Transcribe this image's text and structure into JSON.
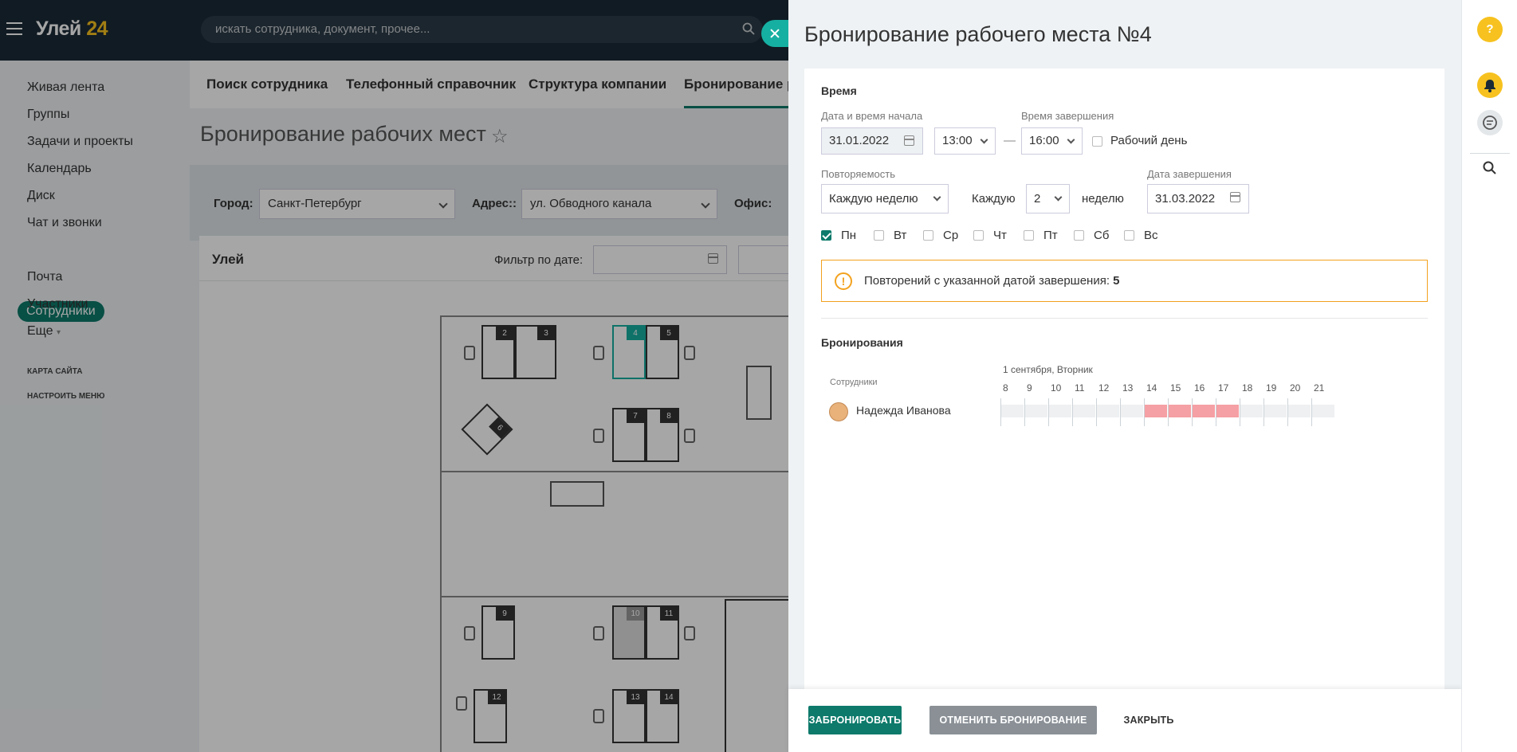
{
  "header": {
    "logo_main": "Улей",
    "logo_num": "24",
    "search_placeholder": "искать сотрудника, документ, прочее..."
  },
  "left_menu": {
    "items": [
      "Живая лента",
      "Группы",
      "Задачи и проекты",
      "Календарь",
      "Диск",
      "Чат и звонки",
      "Сотрудники",
      "Почта",
      "Участники",
      "Еще"
    ],
    "more_suffix": "▾",
    "captions": [
      "КАРТА САЙТА",
      "НАСТРОИТЬ МЕНЮ"
    ]
  },
  "main": {
    "tabs": [
      "Поиск сотрудника",
      "Телефонный справочник",
      "Структура компании",
      "Бронирование ра"
    ],
    "page_title": "Бронирование рабочих мест",
    "filter": {
      "city_label": "Город:",
      "city_value": "Санкт-Петербург",
      "address_label": "Адрес::",
      "address_value": "ул. Обводного канала",
      "office_label": "Офис:"
    },
    "card_title": "Улей",
    "date_filter_label": "Фильтр по дате:",
    "desks": [
      "2",
      "3",
      "4",
      "5",
      "6",
      "7",
      "8",
      "9",
      "10",
      "11",
      "12",
      "13",
      "14"
    ]
  },
  "slider": {
    "title": "Бронирование рабочего места №4",
    "time_section": "Время",
    "start_label": "Дата и время начала",
    "start_date": "31.01.2022",
    "start_time": "13:00",
    "dash": "—",
    "end_label": "Время завершения",
    "end_time": "16:00",
    "workday_label": "Рабочий день",
    "repeat_label": "Повторяемость",
    "repeat_value": "Каждую неделю",
    "every_label": "Каждую",
    "every_value": "2",
    "every_unit": "неделю",
    "end_date_label": "Дата завершения",
    "end_date": "31.03.2022",
    "days": [
      {
        "label": "Пн",
        "checked": true
      },
      {
        "label": "Вт",
        "checked": false
      },
      {
        "label": "Ср",
        "checked": false
      },
      {
        "label": "Чт",
        "checked": false
      },
      {
        "label": "Пт",
        "checked": false
      },
      {
        "label": "Сб",
        "checked": false
      },
      {
        "label": "Вс",
        "checked": false
      }
    ],
    "warning_text": "Повторений с указанной датой завершения:",
    "warning_count": "5",
    "bookings_section": "Бронирования",
    "timeline": {
      "date_header": "1 сентября, Вторник",
      "employees_label": "Сотрудники",
      "hours": [
        "8",
        "9",
        "10",
        "11",
        "12",
        "13",
        "14",
        "15",
        "16",
        "17",
        "18",
        "19",
        "20",
        "21"
      ],
      "employee": "Надежда Иванова",
      "busy_from": "14",
      "busy_to": "18"
    },
    "buttons": {
      "book": "ЗАБРОНИРОВАТЬ",
      "cancel": "ОТМЕНИТЬ БРОНИРОВАНИЕ",
      "close": "ЗАКРЫТЬ"
    }
  },
  "colors": {
    "accent": "#0d7a6b",
    "close_button": "#16b0a2",
    "warning": "#f3a21f",
    "busy": "#f5a0a4",
    "help_badge": "#f7c21f",
    "header_bg": "#1b2a36"
  },
  "right_rail": {
    "icons": [
      "help-icon",
      "bell-icon",
      "chat-icon",
      "search-icon"
    ],
    "help_glyph": "?"
  }
}
